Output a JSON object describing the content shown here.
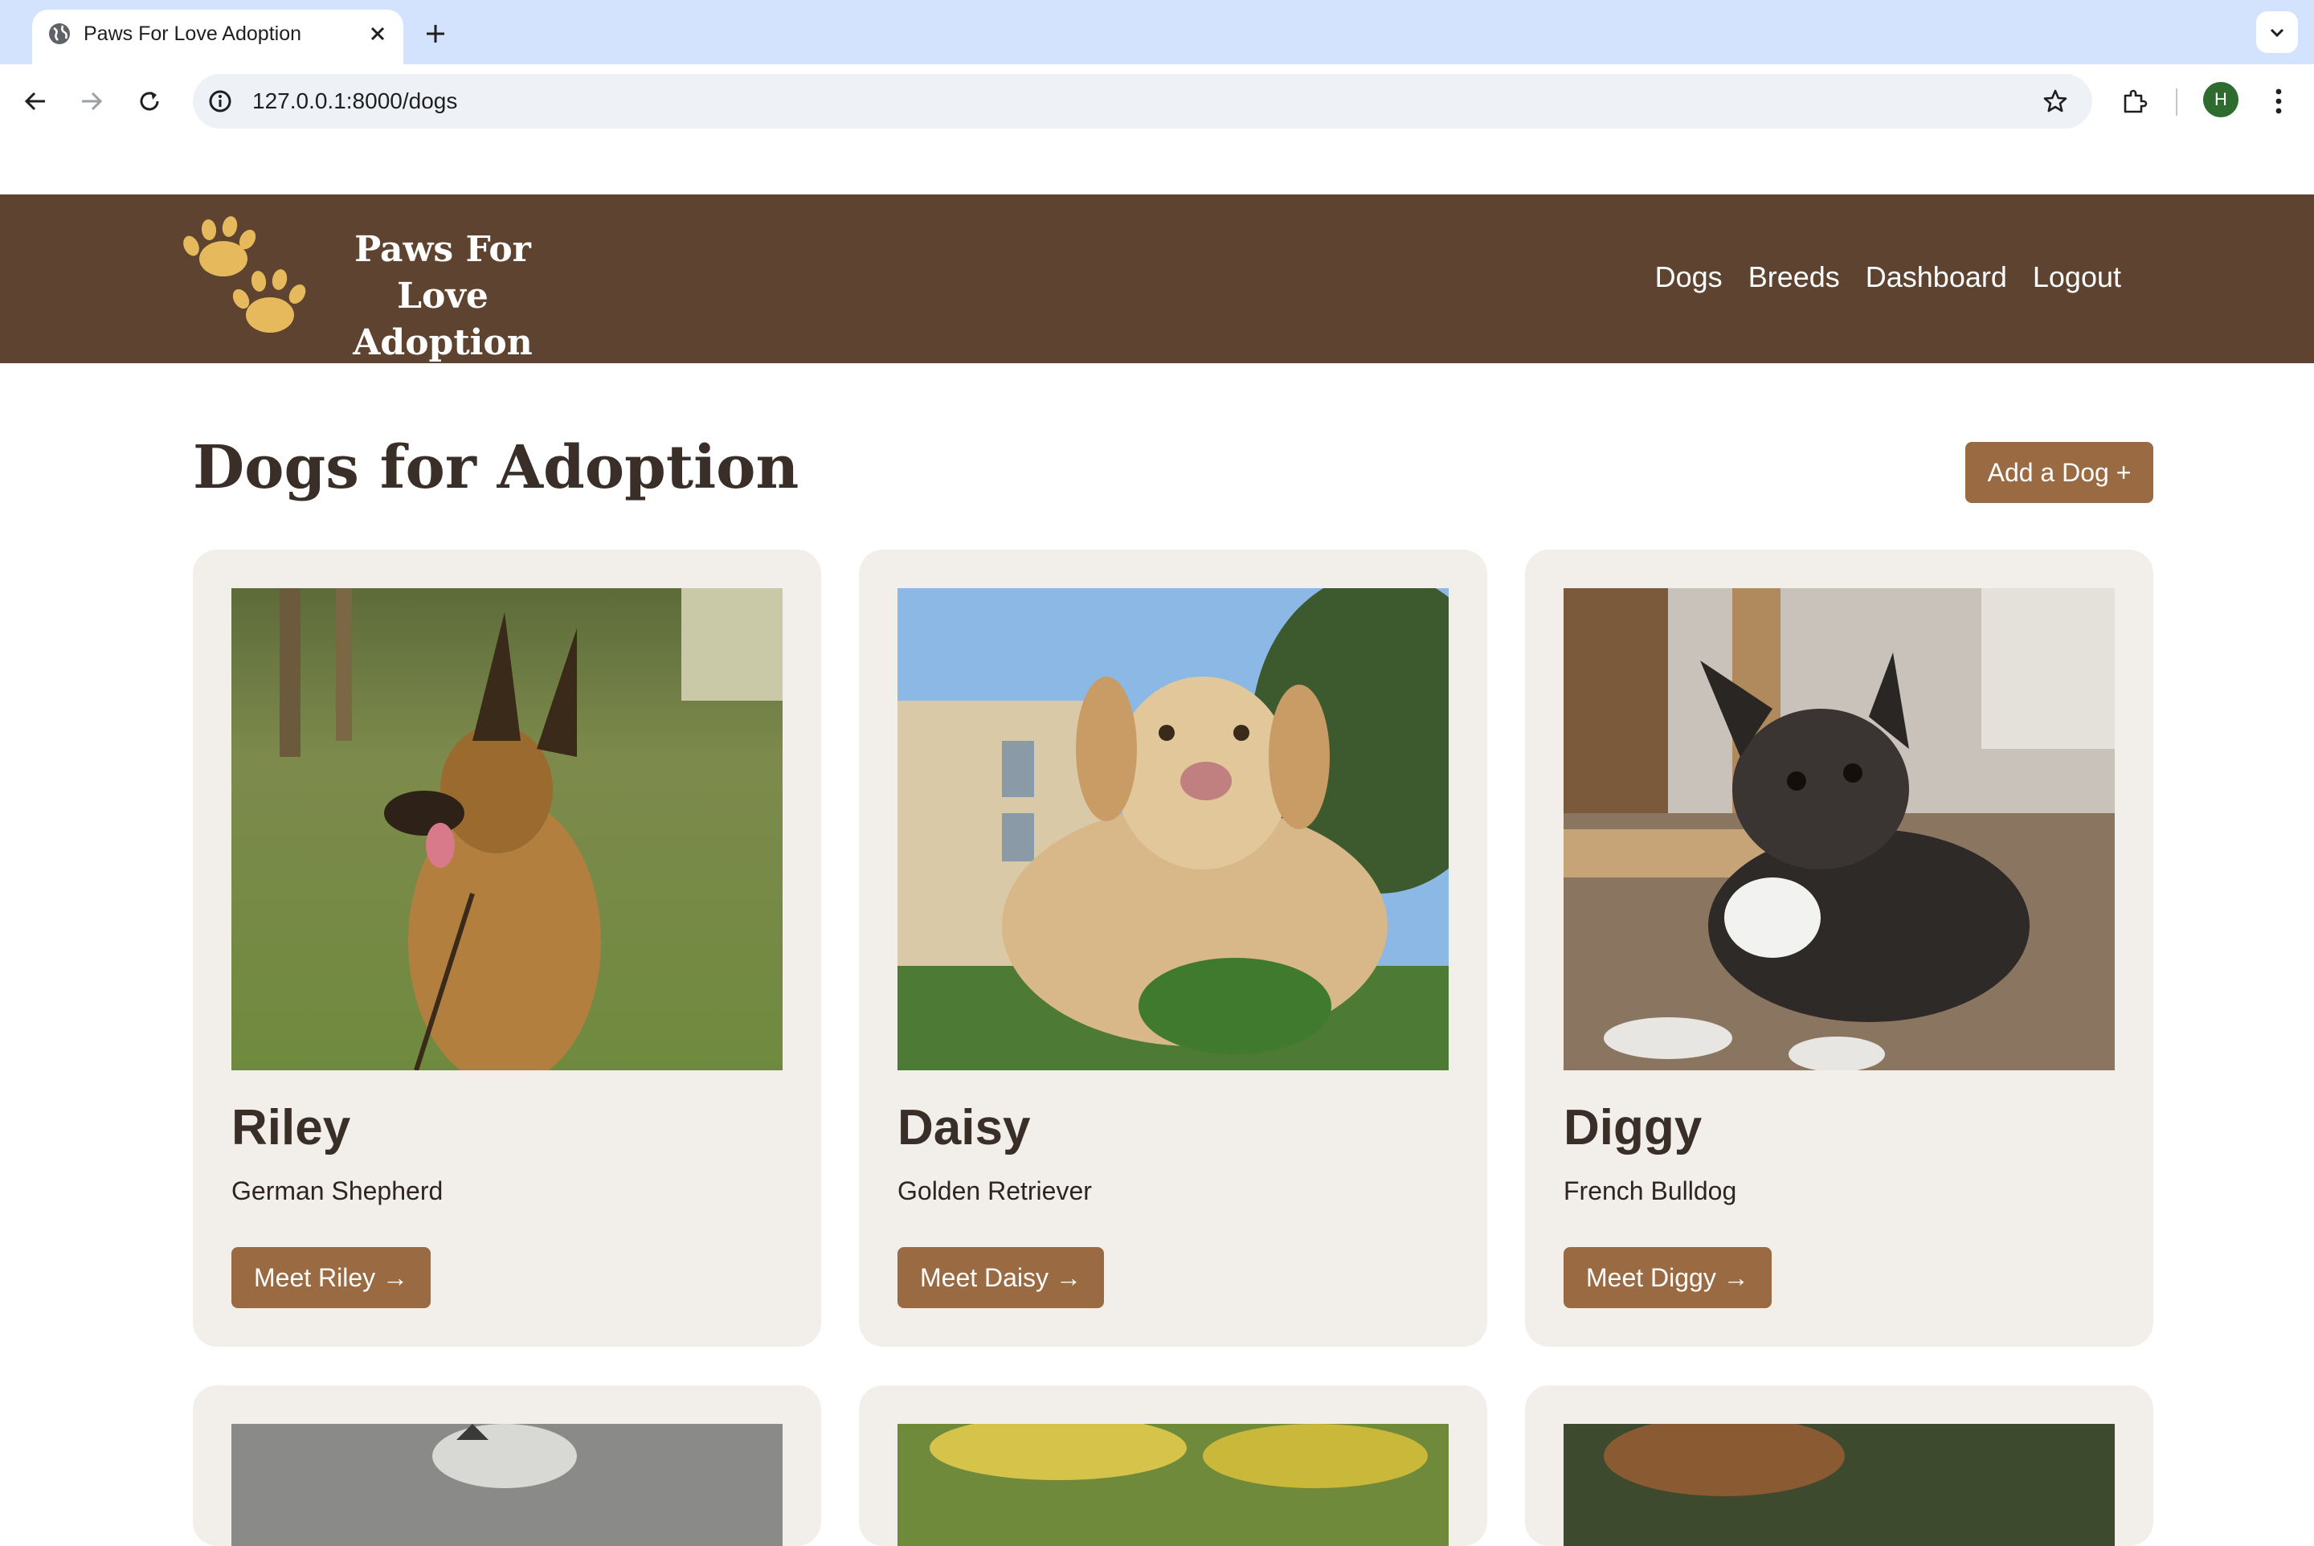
{
  "browser": {
    "tab_title": "Paws For Love Adoption",
    "url": "127.0.0.1:8000/dogs",
    "profile_initial": "H"
  },
  "site": {
    "logo_text": "Paws For Love Adoption",
    "nav": [
      "Dogs",
      "Breeds",
      "Dashboard",
      "Logout"
    ],
    "brand_color": "#5e4430",
    "accent_color": "#9a6b42"
  },
  "page": {
    "title": "Dogs for Adoption",
    "add_button": "Add a Dog +"
  },
  "dogs": [
    {
      "name": "Riley",
      "breed": "German Shepherd",
      "button": "Meet Riley →"
    },
    {
      "name": "Daisy",
      "breed": "Golden Retriever",
      "button": "Meet Daisy →"
    },
    {
      "name": "Diggy",
      "breed": "French Bulldog",
      "button": "Meet Diggy →"
    }
  ]
}
